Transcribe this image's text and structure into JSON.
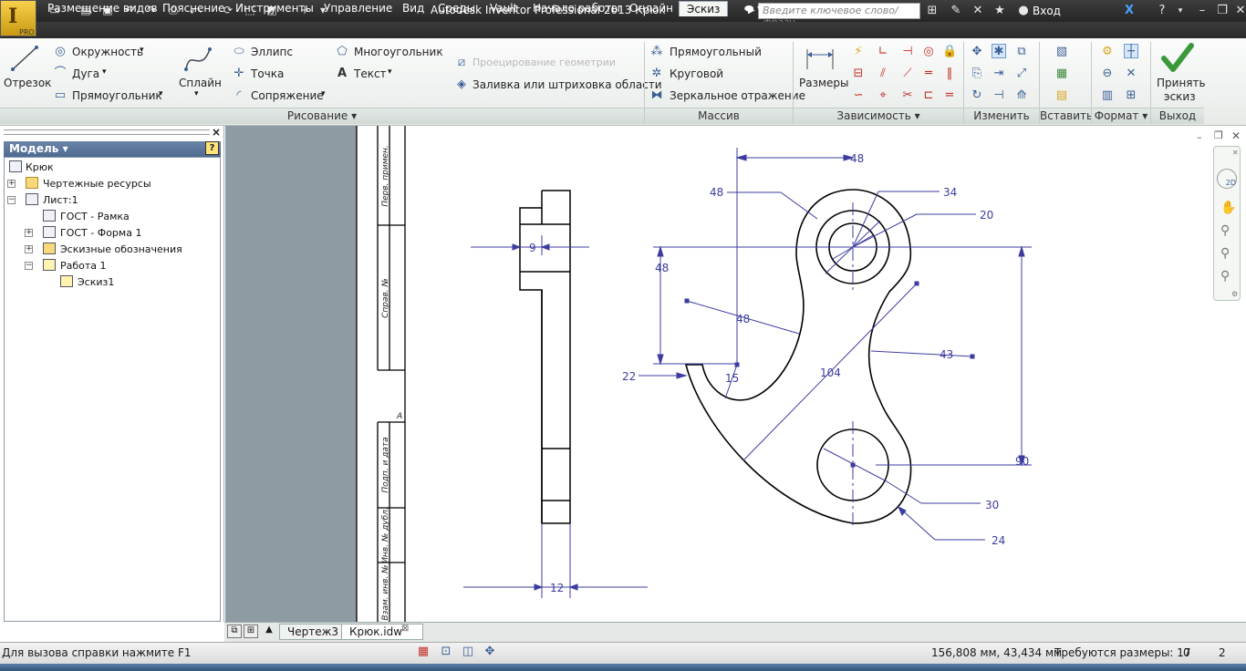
{
  "titlebar": {
    "title": "Autodesk Inventor Professional 2013   Крюк",
    "search_placeholder": "Введите ключевое слово/фразу",
    "login": "Вход",
    "app_badge": "PRO"
  },
  "tabs": [
    {
      "label": "Размещение видов"
    },
    {
      "label": "Пояснение"
    },
    {
      "label": "Инструменты"
    },
    {
      "label": "Управление"
    },
    {
      "label": "Вид"
    },
    {
      "label": "Среды"
    },
    {
      "label": "Vault"
    },
    {
      "label": "Начало работы"
    },
    {
      "label": "Онлайн"
    },
    {
      "label": "Эскиз"
    }
  ],
  "ribbon": {
    "draw": {
      "line": "Отрезок",
      "circle": "Окружность",
      "arc": "Дуга",
      "rectangle": "Прямоугольник",
      "spline": "Сплайн",
      "ellipse": "Эллипс",
      "point": "Точка",
      "fillet": "Сопряжение",
      "polygon": "Многоугольник",
      "text": "Текст",
      "project": "Проецирование геометрии",
      "fill": "Заливка или штриховка области",
      "panel": "Рисование"
    },
    "pattern": {
      "rect": "Прямоугольный",
      "circ": "Круговой",
      "mirror": "Зеркальное отражение",
      "panel": "Массив"
    },
    "constrain": {
      "dimension": "Размеры",
      "panel": "Зависимость"
    },
    "modify": {
      "panel": "Изменить"
    },
    "insert": {
      "panel": "Вставить"
    },
    "format": {
      "panel": "Формат"
    },
    "exit": {
      "accept": "Принять",
      "accept2": "эскиз",
      "panel": "Выход"
    }
  },
  "browser": {
    "header": "Модель",
    "items": [
      {
        "label": "Крюк"
      },
      {
        "label": "Чертежные ресурсы"
      },
      {
        "label": "Лист:1"
      },
      {
        "label": "ГОСТ - Рамка"
      },
      {
        "label": "ГОСТ - Форма 1"
      },
      {
        "label": "Эскизные обозначения"
      },
      {
        "label": "Работа 1"
      },
      {
        "label": "Эскиз1"
      }
    ]
  },
  "frame_text": {
    "perv": "Перв. примен.",
    "sprav": "Справ. №",
    "podp": "Подп. и дата",
    "inv": "Инв. № дубл.",
    "vzam": "Взам. инв. №",
    "a_mark": "А"
  },
  "dimensions": {
    "d9": "9",
    "d12": "12",
    "d48_top": "48",
    "d48_left_lead": "48",
    "d48_vert": "48",
    "d48_arc": "48",
    "d34": "34",
    "d20": "20",
    "d43": "43",
    "d104": "104",
    "d15": "15",
    "d22": "22",
    "d90": "90",
    "d30": "30",
    "d24": "24"
  },
  "doc_tabs": [
    {
      "label": "Чертеж3"
    },
    {
      "label": "Крюк.idw"
    }
  ],
  "status": {
    "help": "Для вызова справки нажмите F1",
    "coords": "156,808 мм, 43,434 мм",
    "required": "Требуются размеры: 17",
    "n1": "0",
    "n2": "2"
  },
  "colors": {
    "dimension": "#3c3ca0",
    "geometry": "#000000",
    "frame_gray": "#8e9ba3"
  }
}
